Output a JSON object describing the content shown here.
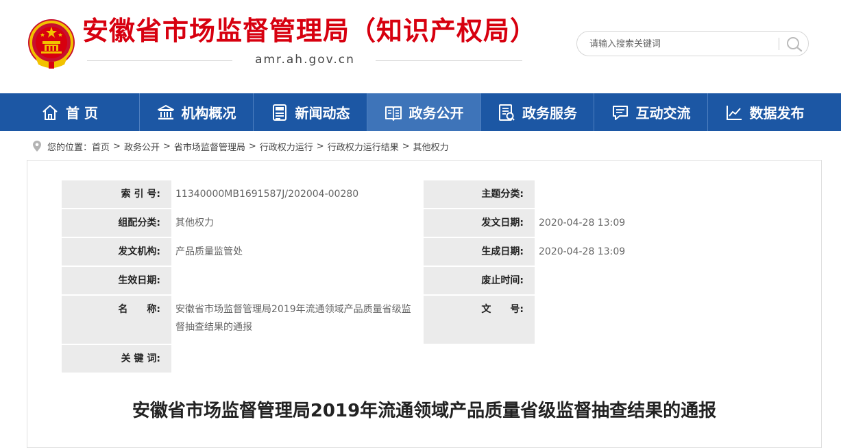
{
  "header": {
    "site_title": "安徽省市场监督管理局（知识产权局）",
    "site_domain": "amr.ah.gov.cn",
    "emblem_icon": "national-emblem-icon",
    "title_color": "#d7000f"
  },
  "search": {
    "placeholder": "请输入搜索关键词",
    "button_icon": "search-icon"
  },
  "nav": {
    "color": "#1c57a4",
    "active_color": "#3e74b9",
    "items": [
      {
        "label": "首 页",
        "icon": "home-icon"
      },
      {
        "label": "机构概况",
        "icon": "building-icon"
      },
      {
        "label": "新闻动态",
        "icon": "news-icon"
      },
      {
        "label": "政务公开",
        "icon": "open-book-icon",
        "active": true
      },
      {
        "label": "政务服务",
        "icon": "service-document-icon"
      },
      {
        "label": "互动交流",
        "icon": "chat-icon"
      },
      {
        "label": "数据发布",
        "icon": "line-chart-icon"
      }
    ]
  },
  "breadcrumb": {
    "icon": "location-pin-icon",
    "prefix": "您的位置：",
    "items": [
      "首页",
      "政务公开",
      "省市场监督管理局",
      "行政权力运行",
      "行政权力运行结果",
      "其他权力"
    ],
    "separator": ">"
  },
  "meta": {
    "index_label": "索 引 号:",
    "index_value": "11340000MB1691587J/202004-00280",
    "topic_label": "主题分类:",
    "topic_value": "",
    "category_label": "组配分类:",
    "category_value": "其他权力",
    "pubdate_label": "发文日期:",
    "pubdate_value": "2020-04-28 13:09",
    "issuer_label": "发文机构:",
    "issuer_value": "产品质量监管处",
    "gendate_label": "生成日期:",
    "gendate_value": "2020-04-28 13:09",
    "effective_label": "生效日期:",
    "effective_value": "",
    "expire_label": "废止时间:",
    "expire_value": "",
    "name_label": "名　　称:",
    "name_value": "安徽省市场监督管理局2019年流通领域产品质量省级监督抽查结果的通报",
    "docno_label": "文　　号:",
    "docno_value": "",
    "keywords_label": "关 键 词:",
    "keywords_value": ""
  },
  "document": {
    "title": "安徽省市场监督管理局2019年流通领域产品质量省级监督抽查结果的通报"
  }
}
